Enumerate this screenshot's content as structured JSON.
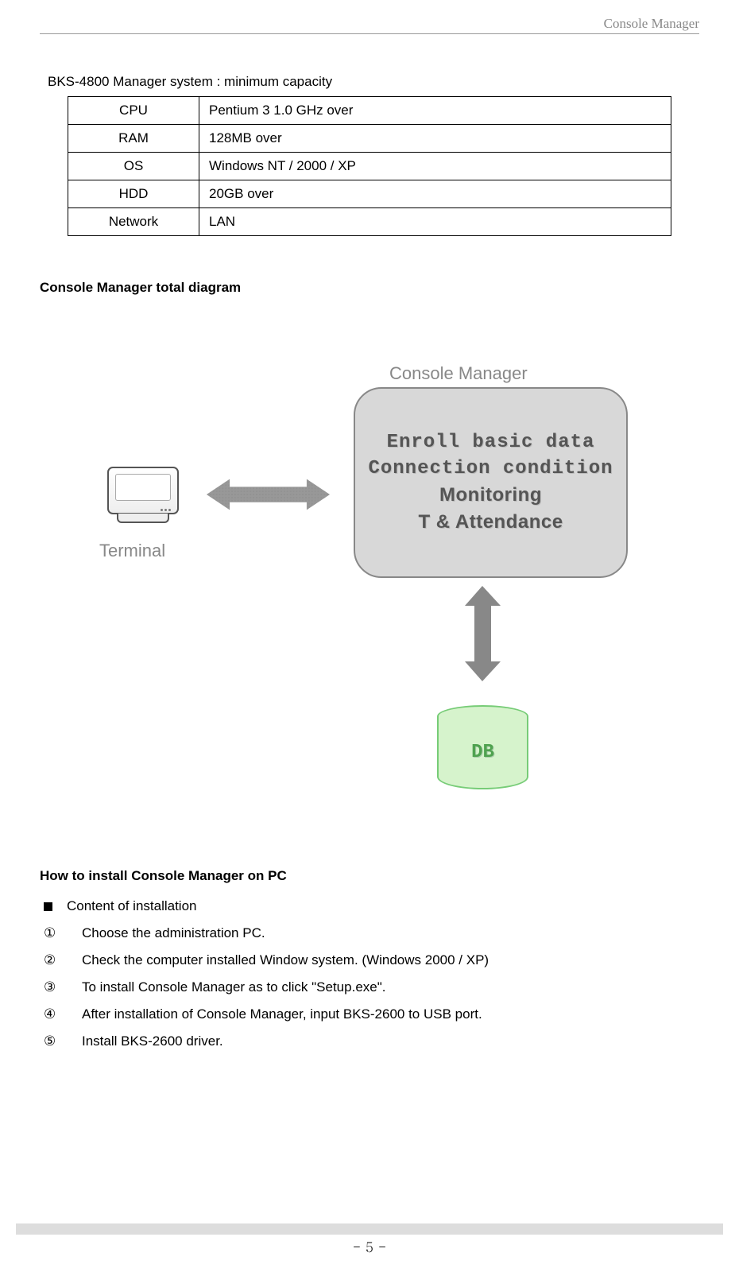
{
  "header_title": "Console Manager",
  "section1_title": "BKS-4800 Manager system : minimum capacity",
  "specs": [
    {
      "k": "CPU",
      "v": "Pentium 3 1.0 GHz over"
    },
    {
      "k": "RAM",
      "v": "128MB over"
    },
    {
      "k": "OS",
      "v": "Windows NT / 2000 / XP"
    },
    {
      "k": "HDD",
      "v": "20GB over"
    },
    {
      "k": "Network",
      "v": "LAN"
    }
  ],
  "section2_title": "Console Manager total diagram",
  "diagram": {
    "terminal_label": "Terminal",
    "console_label": "Console Manager",
    "box_lines": {
      "l1": "Enroll basic data",
      "l2": "Connection condition",
      "l3": "Monitoring",
      "l4": "T & Attendance"
    },
    "db_label": "DB"
  },
  "section3_title": "How to install Console Manager on PC",
  "bullet_label": "Content of installation",
  "steps": [
    {
      "n": "①",
      "t": "Choose the administration PC."
    },
    {
      "n": "②",
      "t": "Check the computer installed Window system. (Windows 2000 / XP)"
    },
    {
      "n": "③",
      "t": "To install Console Manager as to click \"Setup.exe\"."
    },
    {
      "n": "④",
      "t": "After installation of Console Manager, input BKS-2600 to USB port."
    },
    {
      "n": "⑤",
      "t": "Install BKS-2600 driver."
    }
  ],
  "page_number": "- 5 -"
}
